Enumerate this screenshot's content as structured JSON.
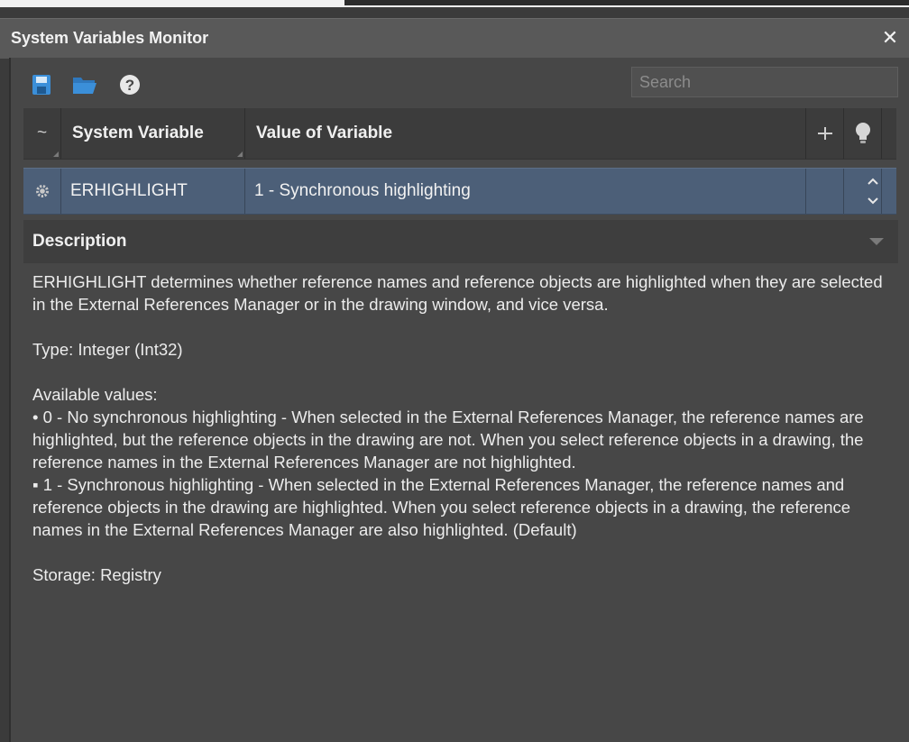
{
  "window": {
    "title": "System Variables Monitor",
    "close_glyph": "✕"
  },
  "toolbar": {
    "icons": [
      "save-icon",
      "open-folder-icon",
      "help-icon"
    ],
    "search": {
      "placeholder": "Search",
      "value": ""
    }
  },
  "grid": {
    "columns": [
      {
        "label": "~"
      },
      {
        "label": "System Variable"
      },
      {
        "label": "Value of Variable"
      },
      {
        "label": "+"
      },
      {
        "label": "lightbulb-icon"
      }
    ],
    "rows": [
      {
        "icon": "gear-icon",
        "variable": "ERHIGHLIGHT",
        "value": "1 - Synchronous highlighting"
      }
    ]
  },
  "description": {
    "header": "Description",
    "paragraph1": "ERHIGHLIGHT determines whether reference names and reference objects are highlighted when they are selected in the External References Manager or in the drawing window, and vice versa.",
    "type_line": "Type: Integer (Int32)",
    "available_label": "Available values:",
    "value0": "• 0 - No synchronous highlighting - When selected in the External References Manager, the reference names are highlighted, but the reference objects in the drawing are not. When you select reference objects in a drawing, the reference names in the External References Manager are not highlighted.",
    "value1_bullet": "▪",
    "value1": "1 - Synchronous highlighting - When selected in the External References Manager, the reference names and reference objects in the drawing are highlighted. When you select reference objects in a drawing, the reference names in the External References Manager are also highlighted. (Default)",
    "storage_line": "Storage: Registry"
  },
  "colors": {
    "selected_row": "#4c5f78",
    "save_icon": "#3b8fd9",
    "folder_icon": "#3b8fd9"
  }
}
